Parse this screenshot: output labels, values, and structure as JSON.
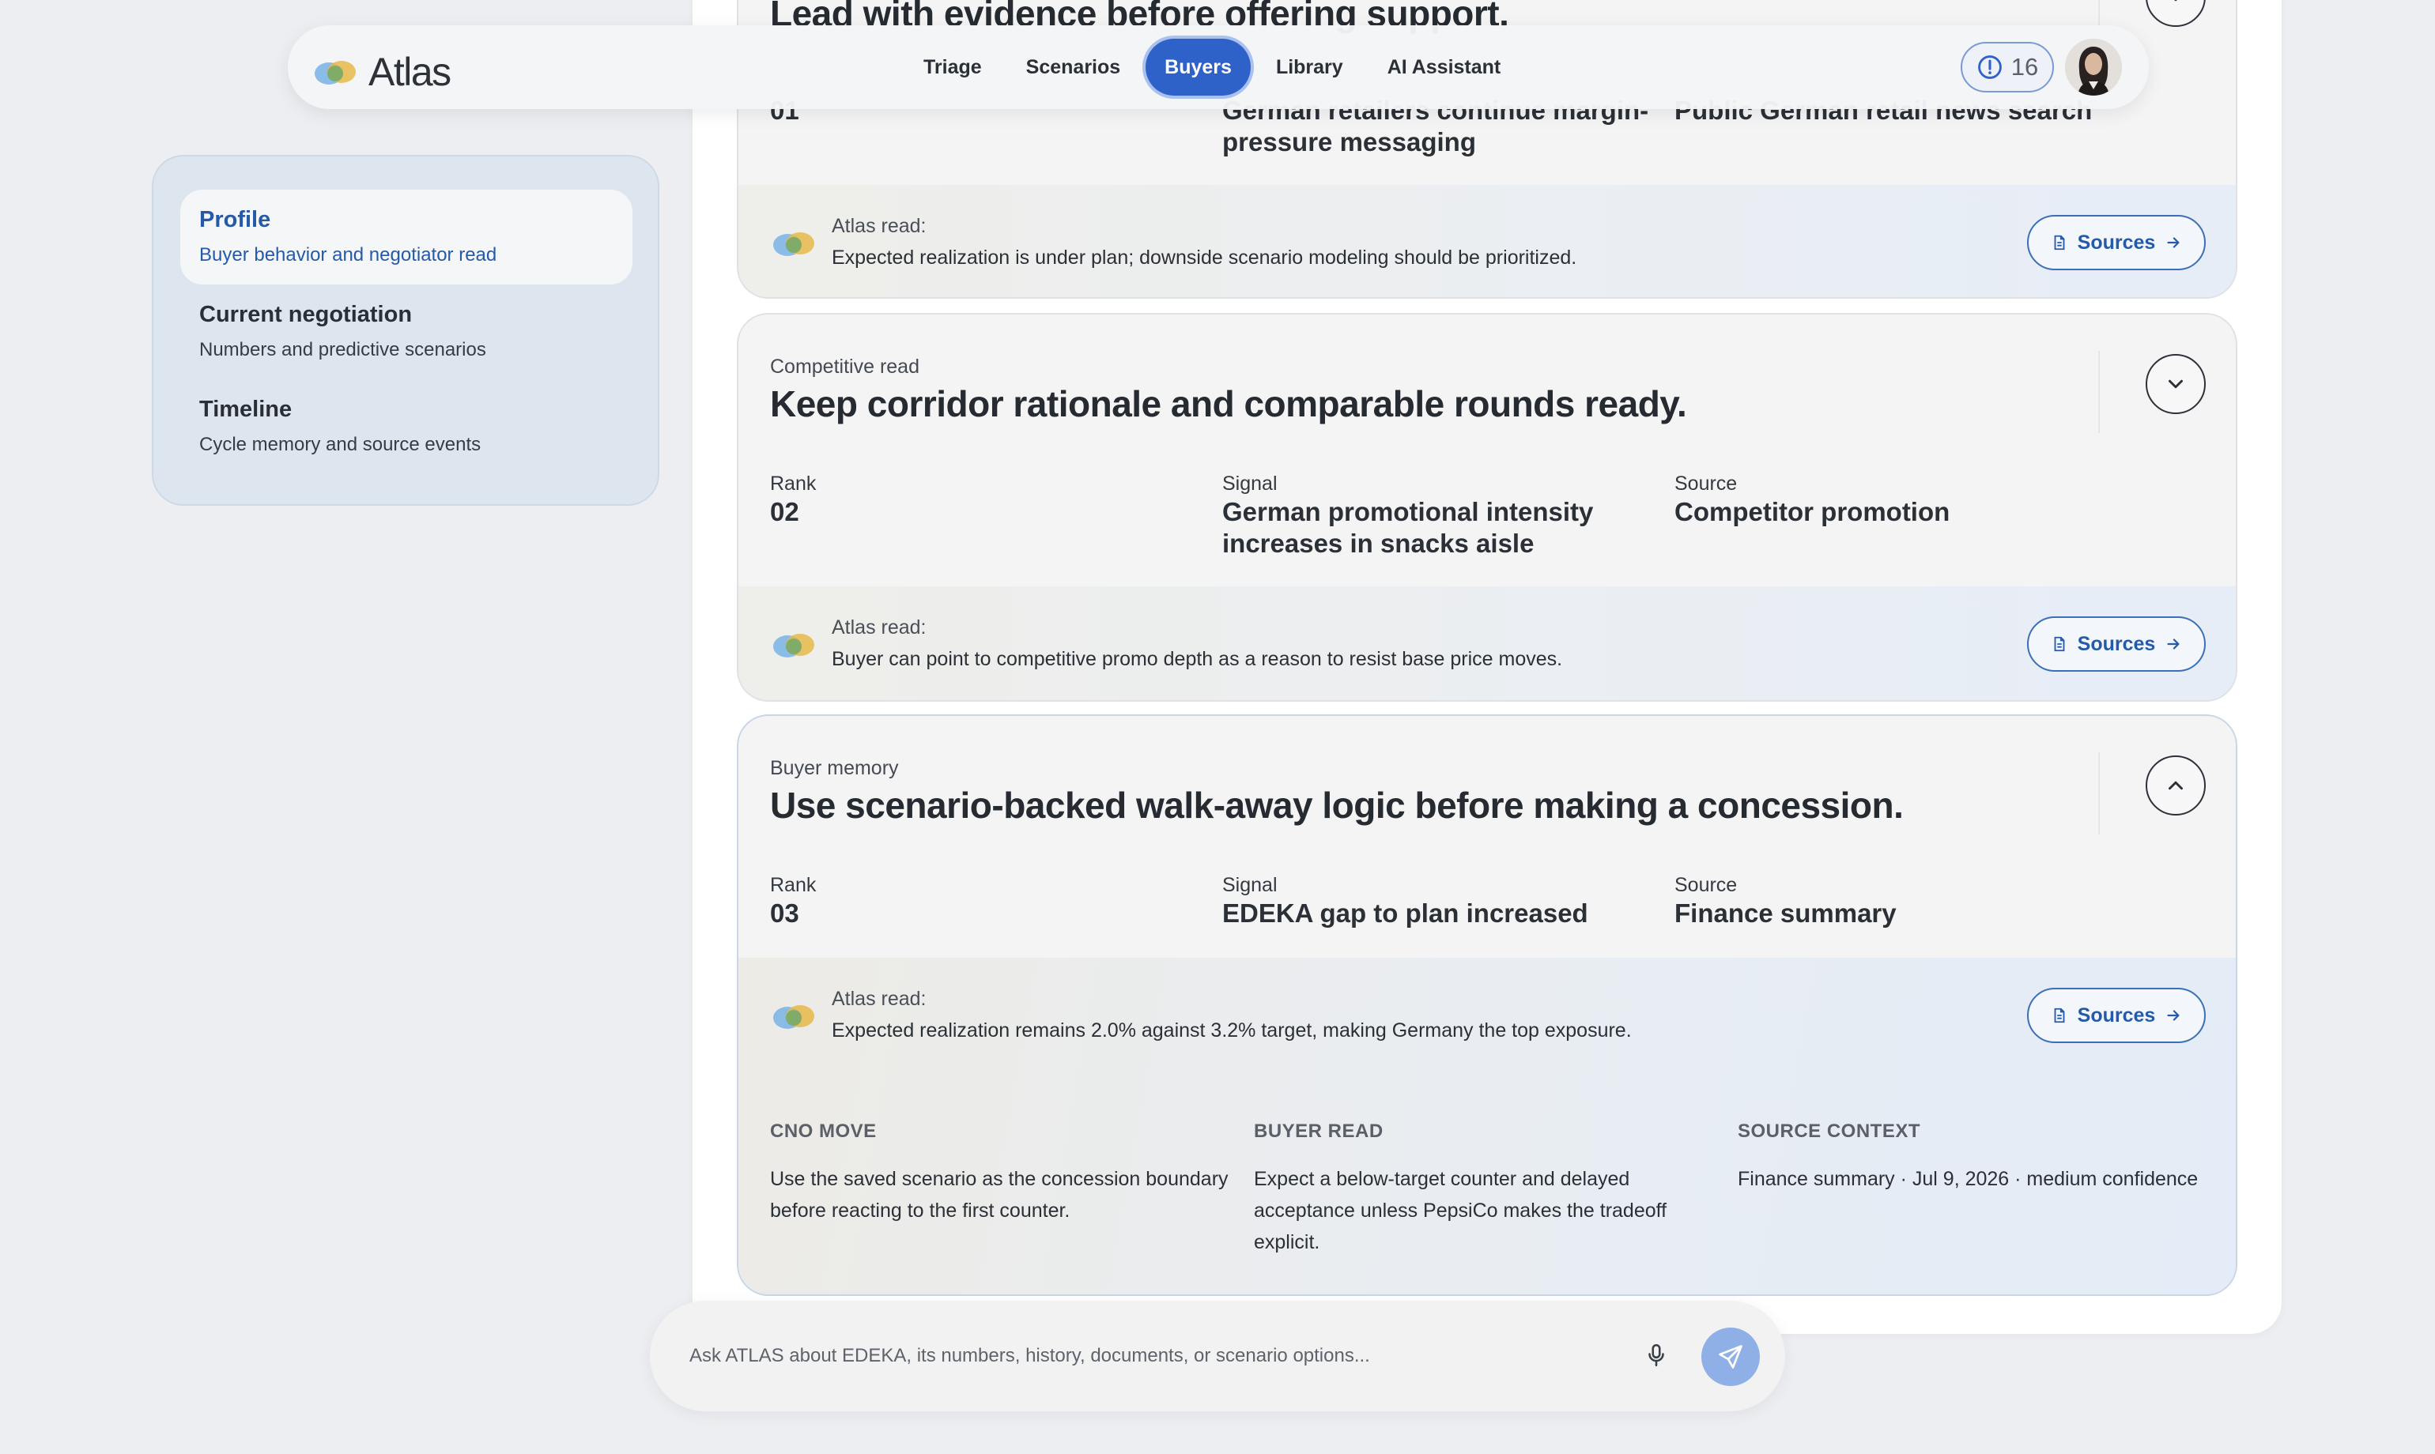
{
  "app": {
    "name": "Atlas"
  },
  "nav": {
    "tabs": [
      {
        "label": "Triage"
      },
      {
        "label": "Scenarios"
      },
      {
        "label": "Buyers",
        "active": true
      },
      {
        "label": "Library"
      },
      {
        "label": "AI Assistant"
      }
    ],
    "alert_count": "16",
    "accent_color": "#2f62c8"
  },
  "sidebar": {
    "items": [
      {
        "title": "Profile",
        "subtitle": "Buyer behavior and negotiator read",
        "active": true
      },
      {
        "title": "Current negotiation",
        "subtitle": "Numbers and predictive scenarios"
      },
      {
        "title": "Timeline",
        "subtitle": "Cycle memory and source events"
      }
    ]
  },
  "cards": [
    {
      "title": "Lead with evidence before offering support.",
      "rank": "01",
      "signal": "German retailers continue margin-pressure messaging",
      "source": "Public German retail news search",
      "atlas_read_label": "Atlas read:",
      "atlas_read": "Expected realization is under plan; downside scenario modeling should be prioritized.",
      "sources_label": "Sources"
    },
    {
      "category": "Competitive read",
      "title": "Keep corridor rationale and comparable rounds ready.",
      "rank_label": "Rank",
      "rank": "02",
      "signal_label": "Signal",
      "signal": "German promotional intensity increases in snacks aisle",
      "source_label": "Source",
      "source": "Competitor promotion",
      "atlas_read_label": "Atlas read:",
      "atlas_read": "Buyer can point to competitive promo depth as a reason to resist base price moves.",
      "sources_label": "Sources"
    },
    {
      "category": "Buyer memory",
      "title": "Use scenario-backed walk-away logic before making a concession.",
      "rank_label": "Rank",
      "rank": "03",
      "signal_label": "Signal",
      "signal": "EDEKA gap to plan increased",
      "source_label": "Source",
      "source": "Finance summary",
      "atlas_read_label": "Atlas read:",
      "atlas_read": "Expected realization remains 2.0% against 3.2% target, making Germany the top exposure.",
      "sources_label": "Sources",
      "details": [
        {
          "heading": "CNO MOVE",
          "text": "Use the saved scenario as the concession boundary before reacting to the first counter."
        },
        {
          "heading": "BUYER READ",
          "text": "Expect a below-target counter and delayed acceptance unless PepsiCo makes the tradeoff explicit."
        },
        {
          "heading": "SOURCE CONTEXT",
          "text": "Finance summary · Jul 9, 2026 · medium confidence"
        }
      ]
    }
  ],
  "ask": {
    "placeholder": "Ask ATLAS about EDEKA, its numbers, history, documents, or scenario options..."
  }
}
